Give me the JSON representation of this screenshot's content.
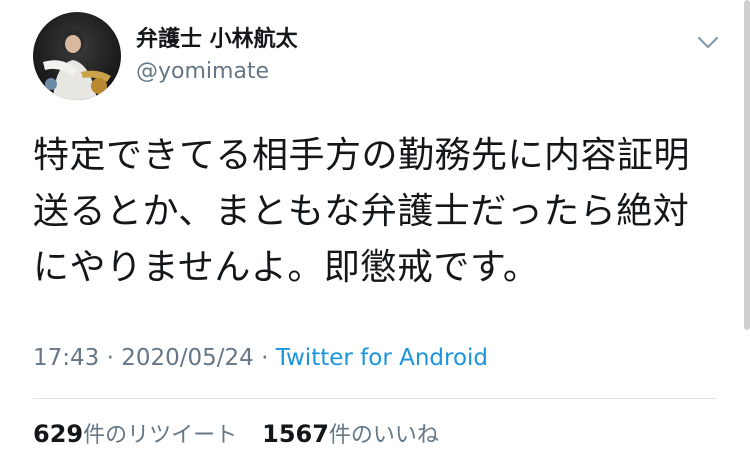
{
  "user": {
    "display_name": "弁護士 小林航太",
    "handle": "@yomimate",
    "avatar_icon": "avatar-photo"
  },
  "menu": {
    "icon": "chevron-down-icon"
  },
  "tweet": {
    "lines": [
      "特定できてる相手方の勤務先に内容証明",
      "送るとか、まともな弁護士だったら絶対",
      "にやりませんよ。即懲戒です。"
    ],
    "time": "17:43",
    "date": "2020/05/24",
    "separator": " · ",
    "source": "Twitter for Android"
  },
  "stats": {
    "retweets_count": "629",
    "retweets_label": "件のリツイート",
    "likes_count": "1567",
    "likes_label": "件のいいね"
  },
  "colors": {
    "text": "#14171a",
    "secondary": "#657786",
    "link": "#1b95e0",
    "divider": "#dfe3e6"
  }
}
